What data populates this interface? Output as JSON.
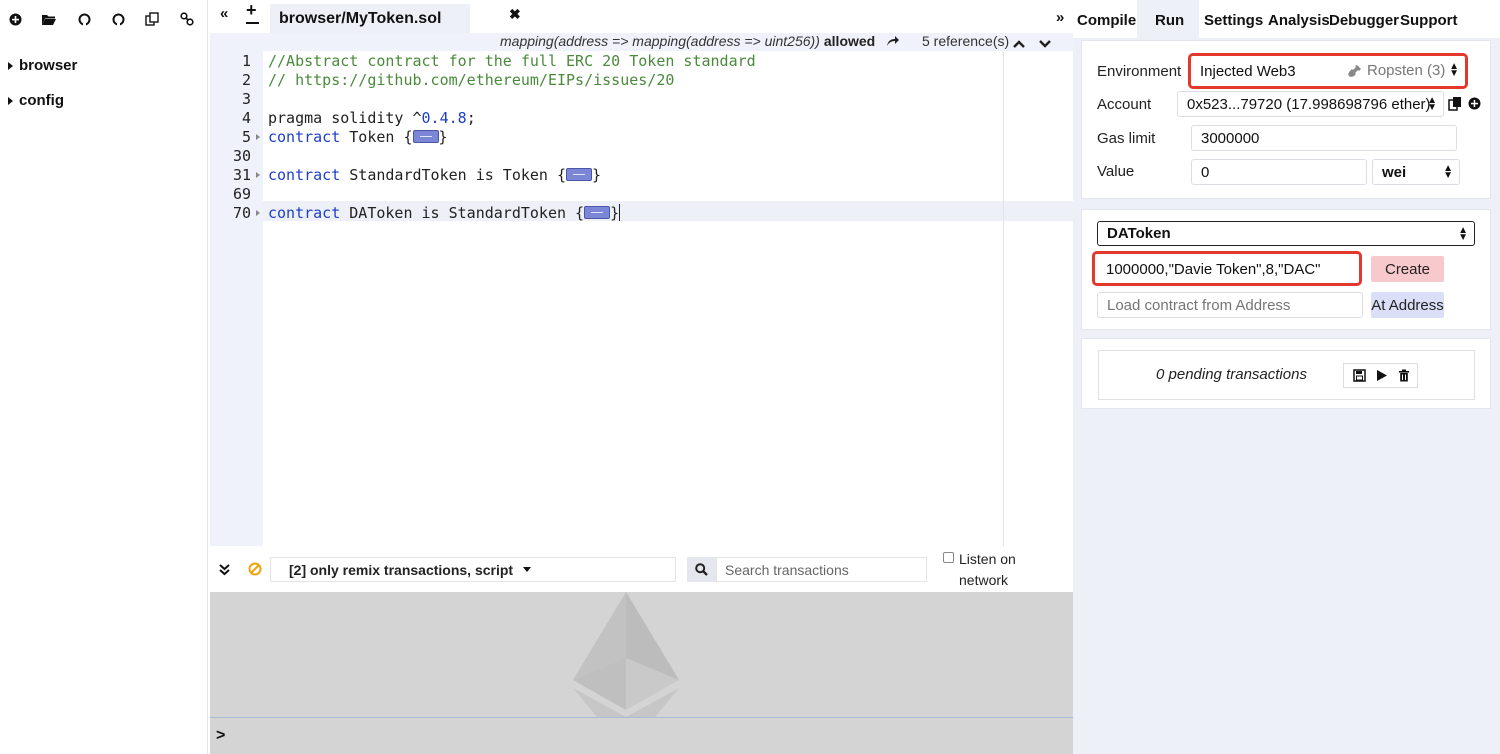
{
  "file_explorer": {
    "tree": [
      {
        "label": "browser"
      },
      {
        "label": "config"
      }
    ]
  },
  "editor": {
    "nav_left": "«",
    "nav_add": "+",
    "active_tab": "browser/MyToken.sol",
    "close_icon": "✖",
    "context_bar": {
      "mapping_text": "mapping(address => mapping(address => uint256))",
      "allowed_text": "allowed",
      "references_text": "5 reference(s)"
    },
    "lines": [
      {
        "num": "1",
        "text": "//Abstract contract for the full ERC 20 Token standard"
      },
      {
        "num": "2",
        "text": "// https://github.com/ethereum/EIPs/issues/20"
      },
      {
        "num": "3",
        "text": ""
      },
      {
        "num": "4",
        "keyword": "pragma solidity ^",
        "version": "0.4.8",
        "tail": ";"
      },
      {
        "num": "5",
        "keyword": "contract",
        "rest": " Token {"
      },
      {
        "num": "30",
        "text": ""
      },
      {
        "num": "31",
        "keyword": "contract",
        "rest": " StandardToken is Token {"
      },
      {
        "num": "69",
        "text": ""
      },
      {
        "num": "70",
        "keyword": "contract",
        "rest": " DAToken is StandardToken {"
      }
    ],
    "close_brace": "}"
  },
  "terminal": {
    "filter_label": "[2] only remix transactions, script",
    "search_placeholder": "Search transactions",
    "listen_label": "Listen on network",
    "prompt": ">"
  },
  "right_panel": {
    "collapse_label": "»",
    "tabs": [
      "Compile",
      "Run",
      "Settings",
      "Analysis",
      "Debugger",
      "Support"
    ],
    "active_tab": "Run",
    "environment": {
      "label": "Environment",
      "value": "Injected Web3",
      "network": "Ropsten (3)"
    },
    "account": {
      "label": "Account",
      "value": "0x523...79720 (17.998698796 ether)"
    },
    "gas_limit": {
      "label": "Gas limit",
      "value": "3000000"
    },
    "value": {
      "label": "Value",
      "amount": "0",
      "unit": "wei"
    },
    "contract_select": "DAToken",
    "constructor_args": "1000000,\"Davie Token\",8,\"DAC\"",
    "create_button": "Create",
    "load_placeholder": "Load contract from Address",
    "at_address_button": "At Address",
    "pending_transactions": "0 pending transactions"
  },
  "colors": {
    "highlight_border": "#e5382c",
    "create_button_bg": "#f8c9cc",
    "at_address_bg": "#dadff7",
    "panel_bg": "#eef0f8"
  },
  "icons": [
    "add-file-icon",
    "open-folder-icon",
    "github-icon",
    "gist-icon",
    "copy-icon",
    "link-icon",
    "pin-icon",
    "copy-address-icon",
    "add-account-icon",
    "search-icon",
    "save-icon",
    "play-icon",
    "trash-icon",
    "clear-icon",
    "collapse-terminal-icon",
    "arrow-up-icon",
    "arrow-down-icon",
    "jump-arrow-icon"
  ]
}
